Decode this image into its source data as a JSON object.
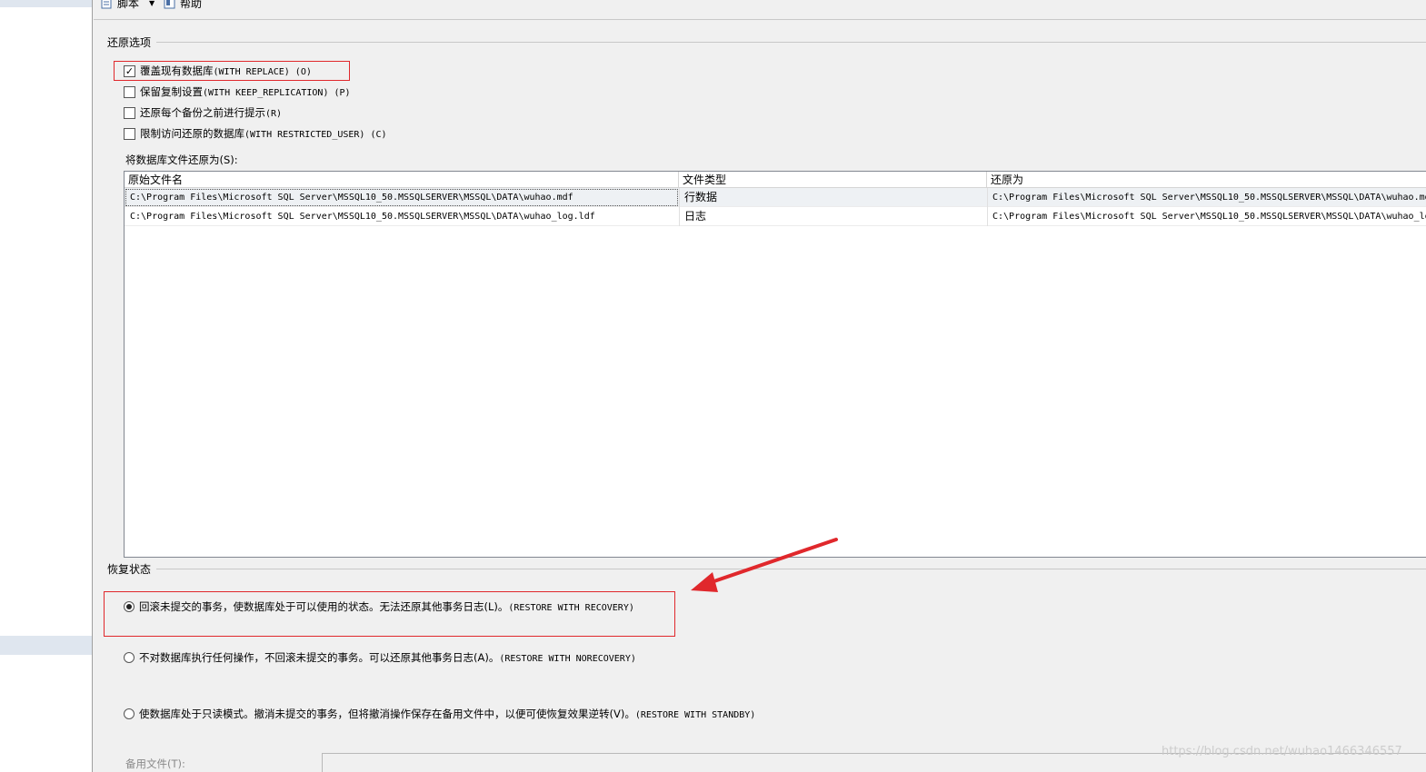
{
  "toolbar": {
    "script_label": "脚本",
    "help_label": "帮助"
  },
  "restore_options": {
    "title": "还原选项",
    "checkboxes": [
      {
        "label_cn": "覆盖现有数据库",
        "label_code": "(WITH REPLACE) (O)",
        "checked": true
      },
      {
        "label_cn": "保留复制设置",
        "label_code": "(WITH KEEP_REPLICATION) (P)",
        "checked": false
      },
      {
        "label_cn": "还原每个备份之前进行提示",
        "label_code": "(R)",
        "checked": false
      },
      {
        "label_cn": "限制访问还原的数据库",
        "label_code": "(WITH RESTRICTED_USER) (C)",
        "checked": false
      }
    ]
  },
  "files": {
    "label": "将数据库文件还原为(S):",
    "columns": [
      "原始文件名",
      "文件类型",
      "还原为"
    ],
    "rows": [
      {
        "original": "C:\\Program Files\\Microsoft SQL Server\\MSSQL10_50.MSSQLSERVER\\MSSQL\\DATA\\wuhao.mdf",
        "type": "行数据",
        "restore_as": "C:\\Program Files\\Microsoft SQL Server\\MSSQL10_50.MSSQLSERVER\\MSSQL\\DATA\\wuhao.mdf"
      },
      {
        "original": "C:\\Program Files\\Microsoft SQL Server\\MSSQL10_50.MSSQLSERVER\\MSSQL\\DATA\\wuhao_log.ldf",
        "type": "日志",
        "restore_as": "C:\\Program Files\\Microsoft SQL Server\\MSSQL10_50.MSSQLSERVER\\MSSQL\\DATA\\wuhao_log.ldf"
      }
    ]
  },
  "recovery_state": {
    "title": "恢复状态",
    "options": [
      {
        "label_cn": "回滚未提交的事务，使数据库处于可以使用的状态。无法还原其他事务日志(L)。",
        "label_code": "(RESTORE WITH RECOVERY)",
        "selected": true
      },
      {
        "label_cn": "不对数据库执行任何操作，不回滚未提交的事务。可以还原其他事务日志(A)。",
        "label_code": "(RESTORE WITH NORECOVERY)",
        "selected": false
      },
      {
        "label_cn": "使数据库处于只读模式。撤消未提交的事务，但将撤消操作保存在备用文件中，以便可使恢复效果逆转(V)。",
        "label_code": "(RESTORE WITH STANDBY)",
        "selected": false
      }
    ],
    "standby_file_label": "备用文件(T):",
    "standby_file_value": ""
  },
  "watermark": "https://blog.csdn.net/wuhao1466346557",
  "colors": {
    "annotation_red": "#e0282c",
    "background": "#f0f0f0"
  }
}
